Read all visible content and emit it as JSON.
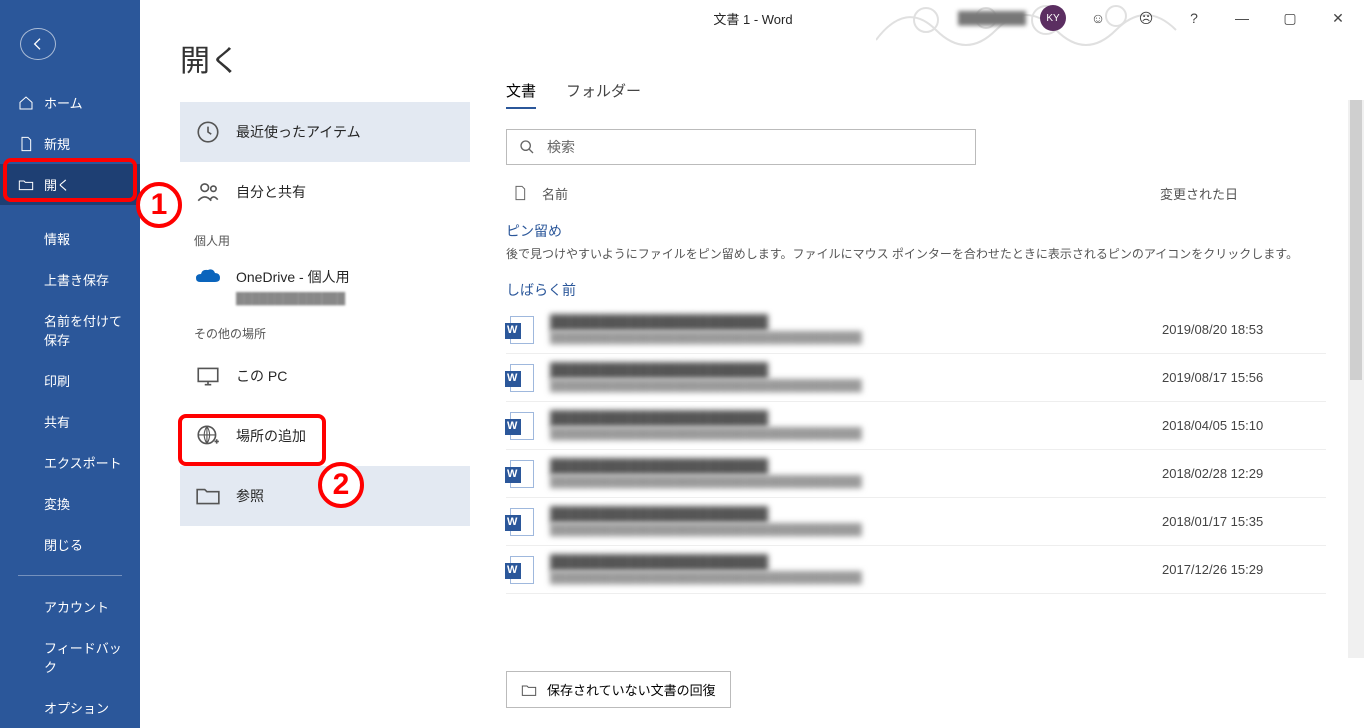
{
  "title": "文書 1  -  Word",
  "user_initials": "KY",
  "page_heading": "開く",
  "sidebar": {
    "home": "ホーム",
    "new": "新規",
    "open": "開く",
    "info": "情報",
    "save": "上書き保存",
    "saveas": "名前を付けて保存",
    "print": "印刷",
    "share": "共有",
    "export": "エクスポート",
    "convert": "変換",
    "close": "閉じる",
    "account": "アカウント",
    "feedback": "フィードバック",
    "options": "オプション"
  },
  "locations": {
    "recent": "最近使ったアイテム",
    "shared": "自分と共有",
    "personal_header": "個人用",
    "onedrive": "OneDrive - 個人用",
    "other_header": "その他の場所",
    "thispc": "この PC",
    "addplace": "場所の追加",
    "browse": "参照"
  },
  "tabs": {
    "docs": "文書",
    "folders": "フォルダー"
  },
  "search_placeholder": "検索",
  "list_header": {
    "name": "名前",
    "modified": "変更された日"
  },
  "pin": {
    "title": "ピン留め",
    "desc": "後で見つけやすいようにファイルをピン留めします。ファイルにマウス ポインターを合わせたときに表示されるピンのアイコンをクリックします。"
  },
  "section_recent": "しばらく前",
  "files": [
    {
      "date": "2019/08/20 18:53"
    },
    {
      "date": "2019/08/17 15:56"
    },
    {
      "date": "2018/04/05 15:10"
    },
    {
      "date": "2018/02/28 12:29"
    },
    {
      "date": "2018/01/17 15:35"
    },
    {
      "date": "2017/12/26 15:29"
    }
  ],
  "recover": "保存されていない文書の回復",
  "annotations": {
    "one": "1",
    "two": "2"
  }
}
